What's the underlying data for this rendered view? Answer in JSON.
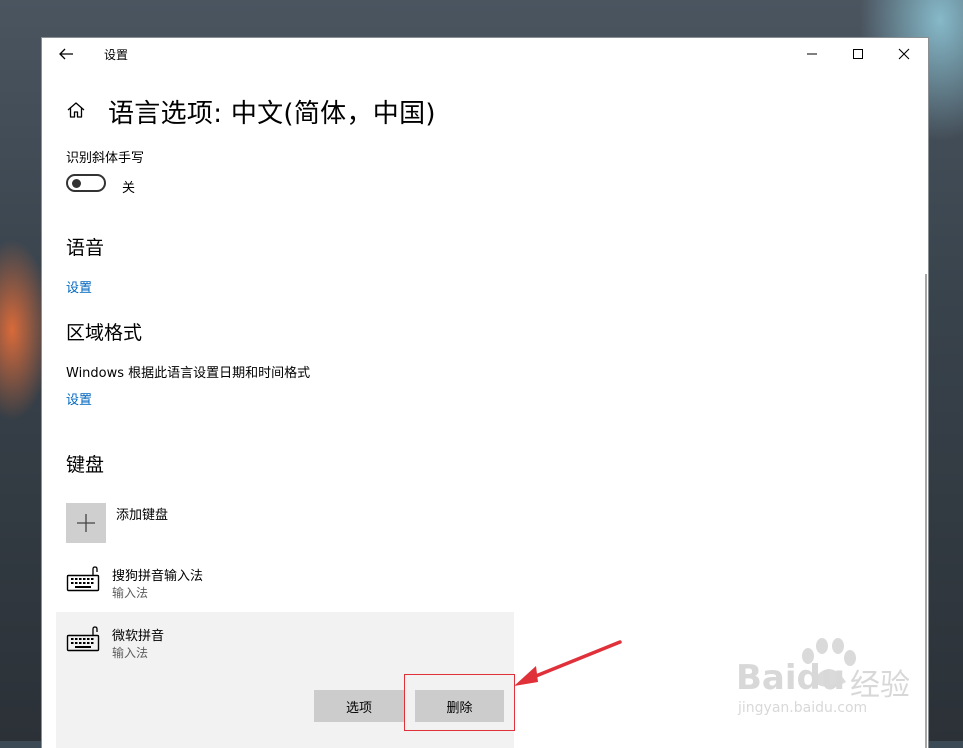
{
  "window": {
    "title": "设置",
    "controls": {
      "minimize": "minimize",
      "maximize": "maximize",
      "close": "close"
    }
  },
  "page": {
    "title": "语言选项: 中文(简体，中国)"
  },
  "handwriting": {
    "label": "识别斜体手写",
    "toggle_state": "关"
  },
  "speech": {
    "heading": "语音",
    "settings_link": "设置"
  },
  "region": {
    "heading": "区域格式",
    "description": "Windows 根据此语言设置日期和时间格式",
    "settings_link": "设置"
  },
  "keyboards": {
    "heading": "键盘",
    "add_label": "添加键盘",
    "items": [
      {
        "name": "搜狗拼音输入法",
        "type": "输入法"
      },
      {
        "name": "微软拼音",
        "type": "输入法"
      }
    ],
    "options_button": "选项",
    "remove_button": "删除"
  },
  "watermark": {
    "brand": "Baidu",
    "brand_cn": "经验",
    "url": "jingyan.baidu.com"
  },
  "colors": {
    "link": "#0067c0",
    "annotation": "#e0303a",
    "button": "#cccccc",
    "selected_panel": "#f2f2f2"
  }
}
